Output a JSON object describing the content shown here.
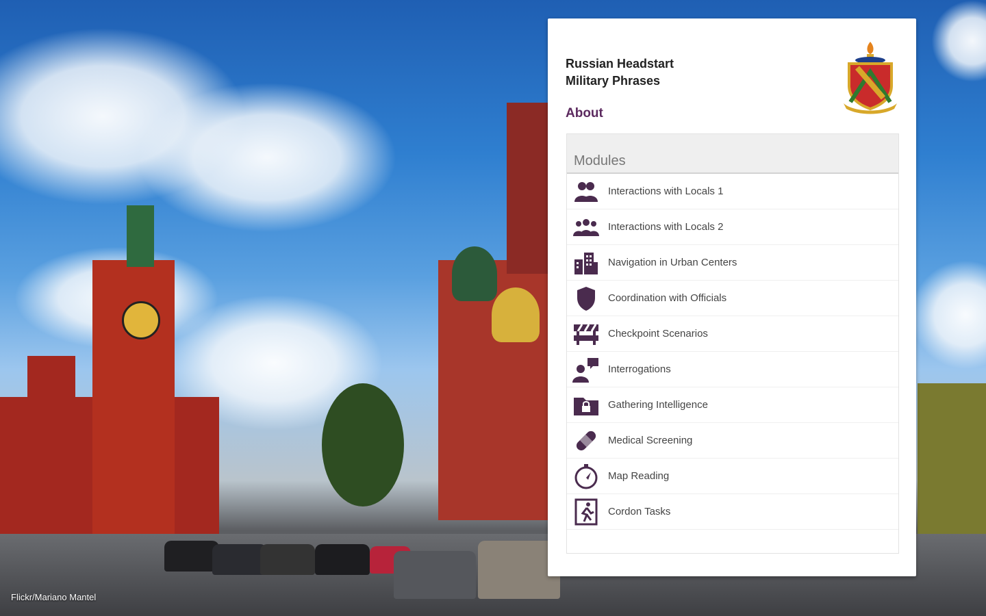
{
  "background": {
    "credit": "Flickr/Mariano Mantel"
  },
  "app": {
    "title_line1": "Russian Headstart",
    "title_line2": "Military Phrases",
    "about_label": "About",
    "accent_color": "#5c2a5f"
  },
  "modules": {
    "header": "Modules",
    "items": [
      {
        "label": "Interactions with Locals 1",
        "icon": "two-people-icon"
      },
      {
        "label": "Interactions with Locals 2",
        "icon": "group-people-icon"
      },
      {
        "label": "Navigation in Urban Centers",
        "icon": "buildings-icon"
      },
      {
        "label": "Coordination with Officials",
        "icon": "badge-shield-icon"
      },
      {
        "label": "Checkpoint Scenarios",
        "icon": "barrier-icon"
      },
      {
        "label": "Interrogations",
        "icon": "speech-person-icon"
      },
      {
        "label": "Gathering Intelligence",
        "icon": "locked-folder-icon"
      },
      {
        "label": "Medical Screening",
        "icon": "bandage-icon"
      },
      {
        "label": "Map Reading",
        "icon": "compass-icon"
      },
      {
        "label": "Cordon Tasks",
        "icon": "exit-running-icon"
      }
    ]
  }
}
